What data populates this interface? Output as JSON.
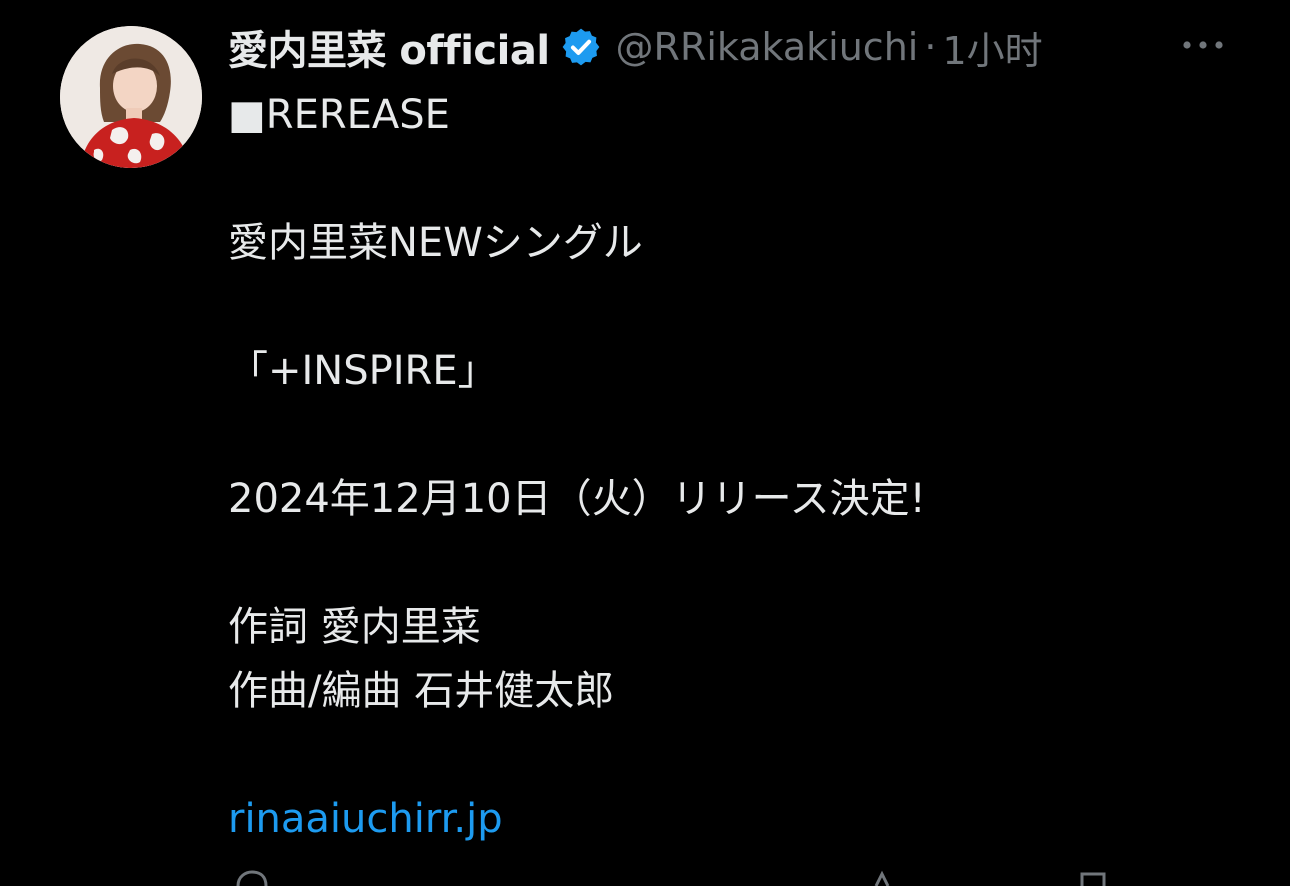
{
  "tweet": {
    "author": {
      "display_name": "愛内里菜 official",
      "handle": "@RRikakakiuchi",
      "separator": "·",
      "time": "1小时",
      "verified": true,
      "avatar_icon": "profile-photo"
    },
    "more_icon": "more-horizontal-icon",
    "lines": [
      "■REREASE",
      "愛内里菜NEWシングル",
      "「+INSPIRE」",
      "2024年12月10日（火）リリース決定!",
      "作詞 愛内里菜",
      "作曲/編曲 石井健太郎"
    ],
    "link": "rinaaiuchirr.jp"
  },
  "theme": {
    "background": "#000000",
    "text": "#e7e9ea",
    "secondary": "#71767b",
    "accent": "#1d9bf0"
  }
}
